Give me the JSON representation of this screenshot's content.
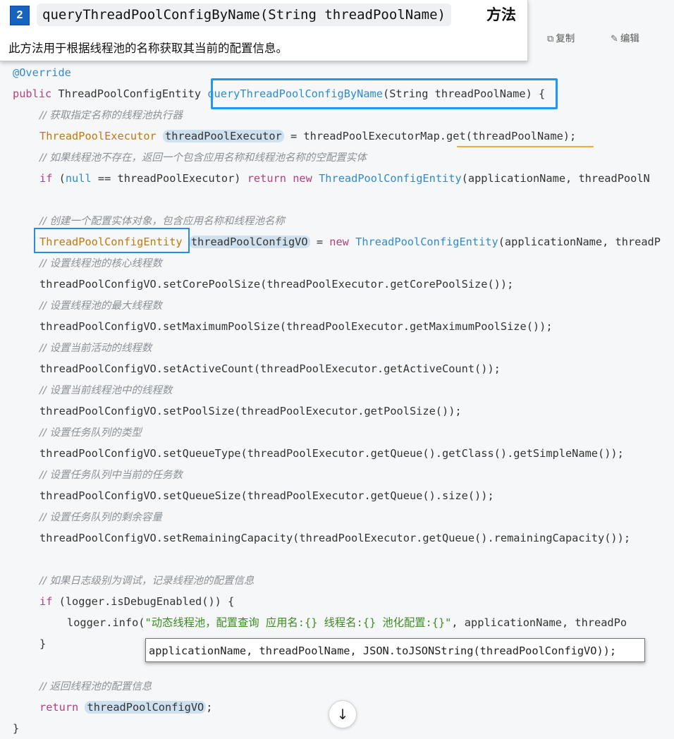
{
  "header": {
    "step_number": "2",
    "signature": "queryThreadPoolConfigByName(String threadPoolName)",
    "signature_suffix": "方法",
    "description": "此方法用于根据线程池的名称获取其当前的配置信息。"
  },
  "toolbar": {
    "copy_label": "复制",
    "edit_label": "编辑"
  },
  "code": {
    "annotation": "@Override",
    "decl_public": "public",
    "decl_type": "ThreadPoolConfigEntity",
    "decl_method": "queryThreadPoolConfigByName",
    "decl_params": "(String threadPoolName)",
    "decl_brace": " {",
    "c1": "// 获取指定名称的线程池执行器",
    "l2_type": "ThreadPoolExecutor",
    "l2_var": "threadPoolExecutor",
    "l2_eq": " = threadPoolExecutorMap.",
    "l2_get": "get(threadPoolName);",
    "c2": "// 如果线程池不存在，返回一个包含应用名称和线程池名称的空配置实体",
    "l3_if": "if",
    "l3_open": " (",
    "l3_null": "null",
    "l3_cond": " == threadPoolExecutor) ",
    "l3_return": "return",
    "l3_new": "new",
    "l3_type": "ThreadPoolConfigEntity",
    "l3_args": "(applicationName, threadPoolN",
    "c3": "// 创建一个配置实体对象，包含应用名称和线程池名称",
    "l4_type": "ThreadPoolConfigEntity",
    "l4_var": "threadPoolConfigVO",
    "l4_eq": " = ",
    "l4_new": "new",
    "l4_ctor": "ThreadPoolConfigEntity",
    "l4_args": "(applicationName, threadP",
    "c4": "// 设置线程池的核心线程数",
    "s1": "threadPoolConfigVO.setCorePoolSize(threadPoolExecutor.getCorePoolSize());",
    "c5": "// 设置线程池的最大线程数",
    "s2": "threadPoolConfigVO.setMaximumPoolSize(threadPoolExecutor.getMaximumPoolSize());",
    "c6": "// 设置当前活动的线程数",
    "s3": "threadPoolConfigVO.setActiveCount(threadPoolExecutor.getActiveCount());",
    "c7": "// 设置当前线程池中的线程数",
    "s4": "threadPoolConfigVO.setPoolSize(threadPoolExecutor.getPoolSize());",
    "c8": "// 设置任务队列的类型",
    "s5": "threadPoolConfigVO.setQueueType(threadPoolExecutor.getQueue().getClass().getSimpleName());",
    "c9": "// 设置任务队列中当前的任务数",
    "s6": "threadPoolConfigVO.setQueueSize(threadPoolExecutor.getQueue().size());",
    "c10": "// 设置任务队列的剩余容量",
    "s7": "threadPoolConfigVO.setRemainingCapacity(threadPoolExecutor.getQueue().remainingCapacity());",
    "c11": "// 如果日志级别为调试，记录线程池的配置信息",
    "if_kw": "if",
    "if_cond": " (logger.isDebugEnabled()) {",
    "log_call": "logger.info(",
    "log_str": "\"动态线程池，配置查询 应用名:{} 线程名:{} 池化配置:{}\"",
    "log_args": ", applicationName, threadPo",
    "close_if": "}",
    "c12": "// 返回线程池的配置信息",
    "ret_kw": "return",
    "ret_var": "threadPoolConfigVO",
    "ret_semi": ";",
    "close_method": "}"
  },
  "popup": {
    "text": "applicationName, threadPoolName, JSON.toJSONString(threadPoolConfigVO));"
  },
  "scroll_button": {
    "icon": "arrow-down-icon",
    "glyph": "↓"
  },
  "colors": {
    "badge": "#1565c0",
    "highlight_box": "#2196f3",
    "underline": "#e8b03a"
  }
}
